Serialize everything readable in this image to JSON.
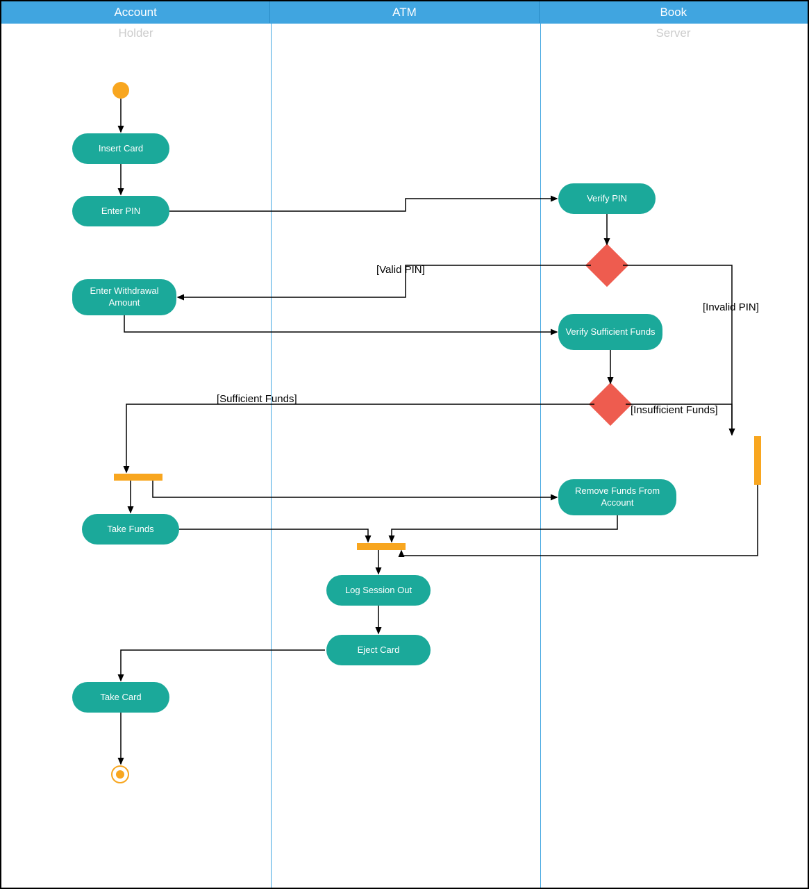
{
  "swimlanes": {
    "col1": {
      "header": "Account",
      "subheader": "Holder"
    },
    "col2": {
      "header": "ATM",
      "subheader": ""
    },
    "col3": {
      "header": "Book",
      "subheader": "Server"
    }
  },
  "nodes": {
    "insert_card": "Insert Card",
    "enter_pin": "Enter PIN",
    "verify_pin": "Verify PIN",
    "enter_withdrawal": "Enter Withdrawal Amount",
    "verify_funds": "Verify Sufficient Funds",
    "remove_funds": "Remove Funds From Account",
    "take_funds": "Take Funds",
    "log_session_out": "Log Session Out",
    "eject_card": "Eject Card",
    "take_card": "Take Card"
  },
  "edge_labels": {
    "valid_pin": "[Valid PIN]",
    "invalid_pin": "[Invalid PIN]",
    "sufficient_funds": "[Sufficient Funds]",
    "insufficient_funds": "[Insufficient Funds]"
  }
}
